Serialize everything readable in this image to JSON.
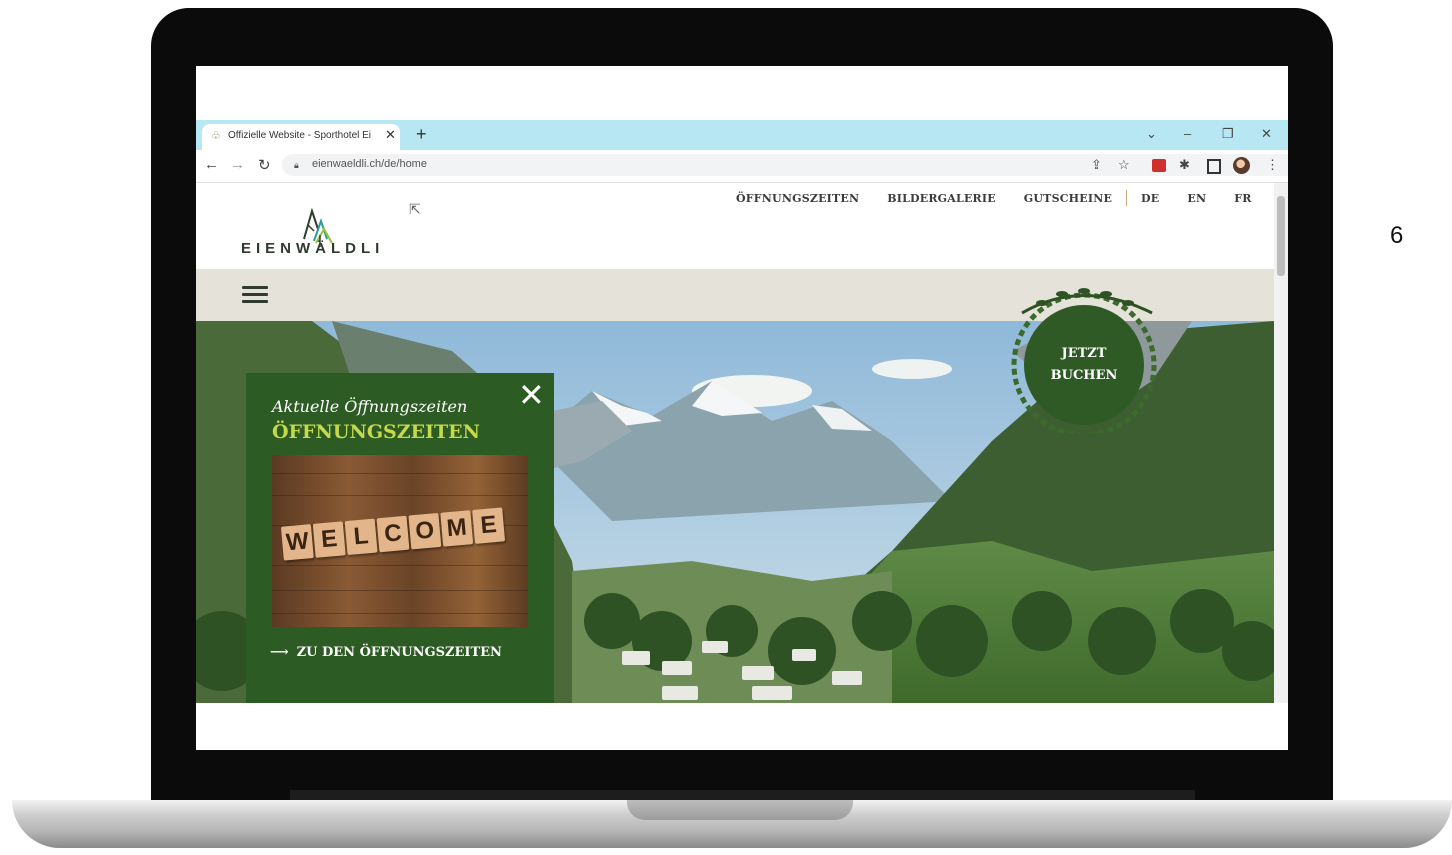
{
  "side_number": "6",
  "browser": {
    "tab_title": "Offizielle Website - Sporthotel Ei",
    "new_tab_symbol": "+",
    "url": "eienwaeldli.ch/de/home"
  },
  "site": {
    "logo_text": "EIENWÄLDLI",
    "nav": [
      "ÖFFNUNGSZEITEN",
      "BILDERGALERIE",
      "GUTSCHEINE"
    ],
    "languages": [
      "DE",
      "EN",
      "FR"
    ],
    "book_button": {
      "line1": "JETZT",
      "line2": "BUCHEN"
    }
  },
  "popup": {
    "script_title": "Aktuelle Öffnungszeiten",
    "title": "ÖFFNUNGSZEITEN",
    "image_letters": [
      "W",
      "E",
      "L",
      "C",
      "O",
      "M",
      "E"
    ],
    "link_text": "ZU DEN ÖFFNUNGSZEITEN"
  },
  "colors": {
    "tab_bar": "#b7e7f2",
    "brand_green": "#2d5b24",
    "accent_lime": "#c6d84b",
    "menu_band": "#e4e2d9"
  },
  "icons": [
    "hamburger-menu-icon",
    "close-icon",
    "arrow-right-icon",
    "back-arrow-icon",
    "forward-arrow-icon",
    "reload-icon",
    "lock-icon",
    "share-icon",
    "star-icon",
    "extensions-icon",
    "sidepanel-icon",
    "profile-avatar-icon",
    "kebab-menu-icon"
  ]
}
